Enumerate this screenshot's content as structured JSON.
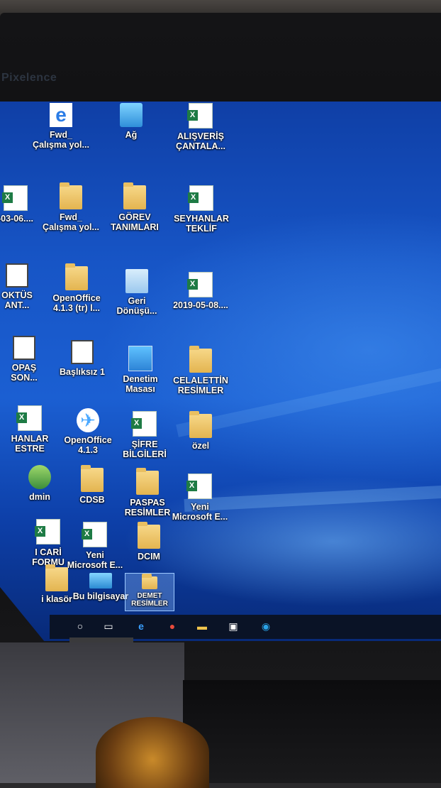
{
  "monitor": {
    "brand": "Pixelence"
  },
  "desktop": {
    "icons": [
      {
        "id": "fwd-calisma-1",
        "label": "Fwd_\nÇalışma yol...",
        "kind": "edge"
      },
      {
        "id": "ag",
        "label": "Ağ",
        "kind": "net"
      },
      {
        "id": "alisveris",
        "label": "ALIŞVERİŞ\nÇANTALA...",
        "kind": "excel"
      },
      {
        "id": "date-03-06",
        "label": "-03-06....",
        "kind": "excel"
      },
      {
        "id": "fwd-calisma-2",
        "label": "Fwd_\nÇalışma yol...",
        "kind": "folder"
      },
      {
        "id": "gorev",
        "label": "GÖREV\nTANIMLARI",
        "kind": "folder"
      },
      {
        "id": "seyhanlar-teklif",
        "label": "SEYHANLAR\nTEKLİF",
        "kind": "excel"
      },
      {
        "id": "oktus",
        "label": "OKTÜS\nANT...",
        "kind": "doc"
      },
      {
        "id": "openoffice-tr",
        "label": "OpenOffice\n4.1.3 (tr) l...",
        "kind": "folder"
      },
      {
        "id": "geri-donusum",
        "label": "Geri\nDönüşü...",
        "kind": "bin"
      },
      {
        "id": "date-2019",
        "label": "2019-05-08....",
        "kind": "excel"
      },
      {
        "id": "opas",
        "label": "OPAŞ\nSON...",
        "kind": "doc"
      },
      {
        "id": "basliksiz",
        "label": "Başlıksız 1",
        "kind": "doc"
      },
      {
        "id": "denetim",
        "label": "Denetim\nMasası",
        "kind": "ctrl"
      },
      {
        "id": "celalettin",
        "label": "CELALETTİN\nRESİMLER",
        "kind": "folder"
      },
      {
        "id": "hanlar",
        "label": "HANLAR\nESTRE",
        "kind": "excel"
      },
      {
        "id": "openoffice",
        "label": "OpenOffice\n4.1.3",
        "kind": "gull"
      },
      {
        "id": "sifre",
        "label": "ŞİFRE\nBİLGİLERİ",
        "kind": "excel"
      },
      {
        "id": "ozel",
        "label": "özel",
        "kind": "folder"
      },
      {
        "id": "admin",
        "label": "dmin",
        "kind": "user"
      },
      {
        "id": "cdsb",
        "label": "CDSB",
        "kind": "folder"
      },
      {
        "id": "paspas",
        "label": "PASPAS\nRESİMLER",
        "kind": "folder"
      },
      {
        "id": "yeni-excel-1",
        "label": "Yeni\nMicrosoft E...",
        "kind": "excel"
      },
      {
        "id": "cari",
        "label": "I CARİ\nFORMU",
        "kind": "excel"
      },
      {
        "id": "yeni-excel-2",
        "label": "Yeni\nMicrosoft E...",
        "kind": "excel"
      },
      {
        "id": "dcim",
        "label": "DCIM",
        "kind": "folder"
      },
      {
        "id": "klasor",
        "label": "i klasör",
        "kind": "folder"
      },
      {
        "id": "bu-bilgisayar",
        "label": "Bu bilgisayar",
        "kind": "pc"
      },
      {
        "id": "demet",
        "label": "DEMET\nRESİMLER",
        "kind": "folder",
        "selected": true
      }
    ]
  },
  "taskbar": {
    "items": [
      {
        "id": "search",
        "icon": "search-icon",
        "glyph": "○"
      },
      {
        "id": "taskview",
        "icon": "task-view-icon",
        "glyph": "▭"
      },
      {
        "id": "edge",
        "icon": "edge-icon",
        "glyph": "e"
      },
      {
        "id": "chrome",
        "icon": "chrome-icon",
        "glyph": "●"
      },
      {
        "id": "explorer",
        "icon": "file-explorer-icon",
        "glyph": "▬"
      },
      {
        "id": "store",
        "icon": "store-icon",
        "glyph": "▣"
      },
      {
        "id": "app",
        "icon": "app-icon",
        "glyph": "◉"
      }
    ]
  }
}
